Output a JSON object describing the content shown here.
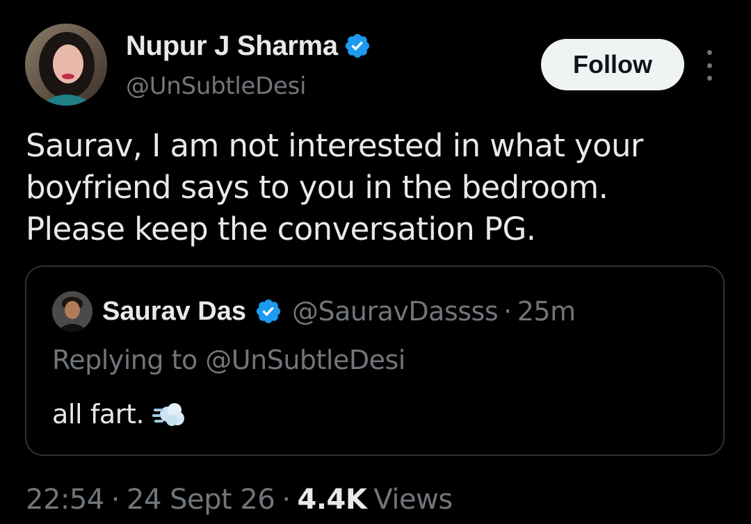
{
  "tweet": {
    "author": {
      "display_name": "Nupur J Sharma",
      "handle": "@UnSubtleDesi",
      "verified": true
    },
    "follow_label": "Follow",
    "more_icon": "more-vertical-icon",
    "text_lines": [
      "Saurav, I am not interested in what your",
      "boyfriend says to you in the bedroom.",
      "Please keep the conversation PG."
    ],
    "quoted": {
      "display_name": "Saurav Das",
      "verified": true,
      "handle": "@SauravDassss",
      "separator": "·",
      "time": "25m",
      "replying_to": "Replying to @UnSubtleDesi",
      "text": "all fart.",
      "emoji_icon": "dashing-away-icon"
    },
    "meta": {
      "time": "22:54",
      "separator": "·",
      "date": "24 Sept 26",
      "views_count": "4.4K",
      "views_label": "Views"
    }
  },
  "colors": {
    "background": "#000000",
    "text_primary": "#e7e9ea",
    "text_secondary": "#71767b",
    "verified_blue": "#1d9bf0",
    "follow_bg": "#eff3f4",
    "border": "#2f3336"
  }
}
